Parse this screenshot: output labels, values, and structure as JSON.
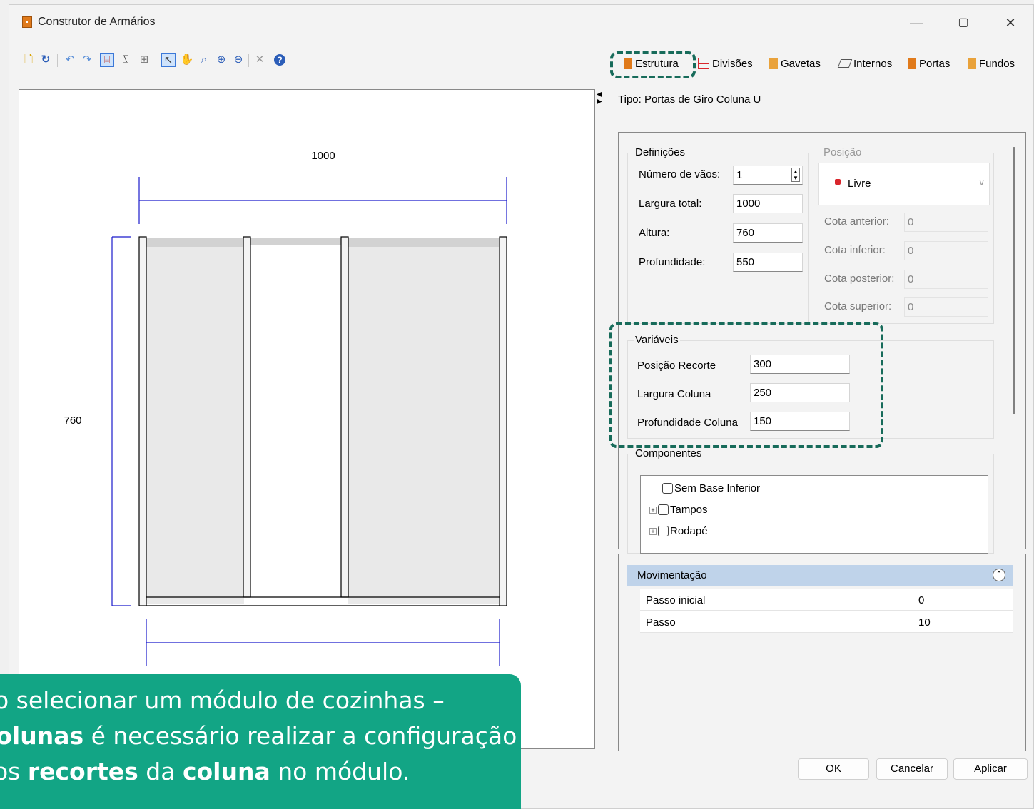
{
  "window": {
    "title": "Construtor de Armários",
    "minimize": "—",
    "maximize": "▢",
    "close": "✕"
  },
  "tabs": [
    {
      "label": "Estrutura",
      "icon": "cabinet-icon",
      "color": "#e07a1b"
    },
    {
      "label": "Divisões",
      "icon": "grid-icon",
      "color": "#d9262c"
    },
    {
      "label": "Gavetas",
      "icon": "drawer-icon",
      "color": "#e9a23b"
    },
    {
      "label": "Internos",
      "icon": "shelf-icon",
      "color": "#555555"
    },
    {
      "label": "Portas",
      "icon": "door-icon",
      "color": "#e07a1b"
    },
    {
      "label": "Fundos",
      "icon": "back-panel-icon",
      "color": "#e9a23b"
    }
  ],
  "drawing": {
    "width_dim": "1000",
    "height_dim": "760"
  },
  "tipo": "Tipo: Portas de Giro Coluna U",
  "definicoes": {
    "title": "Definições",
    "numero_vaos_label": "Número de vãos:",
    "numero_vaos": "1",
    "largura_total_label": "Largura total:",
    "largura_total": "1000",
    "altura_label": "Altura:",
    "altura": "760",
    "profundidade_label": "Profundidade:",
    "profundidade": "550"
  },
  "posicao": {
    "title": "Posição",
    "select_value": "Livre",
    "cota_anterior_label": "Cota anterior:",
    "cota_anterior": "0",
    "cota_inferior_label": "Cota inferior:",
    "cota_inferior": "0",
    "cota_posterior_label": "Cota posterior:",
    "cota_posterior": "0",
    "cota_superior_label": "Cota superior:",
    "cota_superior": "0"
  },
  "variaveis": {
    "title": "Variáveis",
    "posicao_recorte_label": "Posição Recorte",
    "posicao_recorte": "300",
    "largura_coluna_label": "Largura Coluna",
    "largura_coluna": "250",
    "profundidade_coluna_label": "Profundidade Coluna",
    "profundidade_coluna": "150"
  },
  "componentes": {
    "title": "Componentes",
    "items": [
      "Sem Base Inferior",
      "Tampos",
      "Rodapé"
    ]
  },
  "movimentacao": {
    "title": "Movimentação",
    "rows": [
      {
        "key": "Passo inicial",
        "value": "0"
      },
      {
        "key": "Passo",
        "value": "10"
      }
    ]
  },
  "buttons": {
    "ok": "OK",
    "cancel": "Cancelar",
    "apply": "Aplicar"
  },
  "callout": {
    "line1": "Ao selecionar um módulo de cozinhas –",
    "line2_bold": "Colunas",
    "line2_rest": " é necessário realizar a configuração",
    "line3_pre": "dos ",
    "line3_b1": "recortes",
    "line3_mid": " da ",
    "line3_b2": "coluna",
    "line3_post": " no módulo."
  },
  "colors": {
    "accent_highlight": "#176b5a",
    "callout_bg": "#12a585",
    "dimension_line": "#1a1acc"
  }
}
